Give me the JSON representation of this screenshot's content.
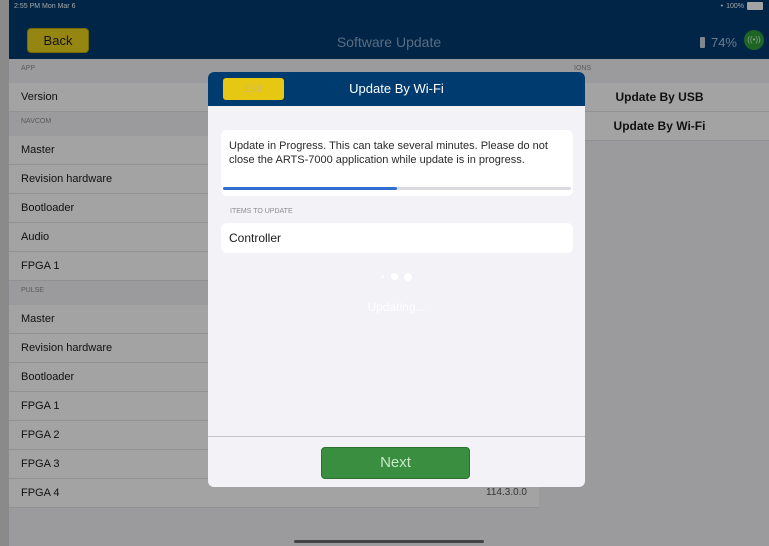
{
  "status": {
    "time": "2:55 PM  Mon Mar 6",
    "wifi": "•",
    "battery": "100%"
  },
  "nav": {
    "back_label": "Back",
    "title": "Software Update",
    "battery_percent": "74%",
    "connection_icon": "((•))"
  },
  "left_sections": [
    {
      "header": "APP",
      "rows": [
        {
          "label": "Version",
          "value": ""
        }
      ]
    },
    {
      "header": "NAVCOM",
      "rows": [
        {
          "label": "Master",
          "value": ""
        },
        {
          "label": "Revision hardware",
          "value": ""
        },
        {
          "label": "Bootloader",
          "value": ""
        },
        {
          "label": "Audio",
          "value": ""
        },
        {
          "label": "FPGA 1",
          "value": ""
        }
      ]
    },
    {
      "header": "PULSE",
      "rows": [
        {
          "label": "Master",
          "value": ""
        },
        {
          "label": "Revision hardware",
          "value": ""
        },
        {
          "label": "Bootloader",
          "value": ""
        },
        {
          "label": "FPGA 1",
          "value": ""
        },
        {
          "label": "FPGA 2",
          "value": ""
        },
        {
          "label": "FPGA 3",
          "value": ""
        },
        {
          "label": "FPGA 4",
          "value": "114.3.0.0"
        }
      ]
    }
  ],
  "right_section": {
    "header": "IONS",
    "options": [
      "Update By USB",
      "Update By Wi-Fi"
    ]
  },
  "modal": {
    "exit_label": "Exit",
    "title": "Update By Wi-Fi",
    "progress_message": "Update in Progress. This can take several minutes. Please do not close the ARTS-7000 application while update is in progress.",
    "progress": 0.5,
    "items_header": "ITEMS TO UPDATE",
    "items": [
      "Controller"
    ],
    "updating_label": "Updating...",
    "next_label": "Next"
  },
  "colors": {
    "nav_blue": "#003b70",
    "accent_yellow": "#e9d01c",
    "next_green": "#3a8e40",
    "progress_blue": "#2f6fd0"
  }
}
